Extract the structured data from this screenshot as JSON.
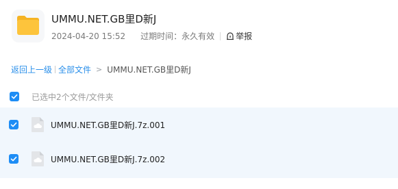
{
  "share": {
    "title": "UMMU.NET.GB里D新J",
    "date": "2024-04-20 15:52",
    "expire_label": "过期时间：永久有效",
    "report_label": "举报"
  },
  "breadcrumb": {
    "back": "返回上一级",
    "all_files": "全部文件",
    "separator": ">",
    "current": "UMMU.NET.GB里D新J"
  },
  "selection": {
    "summary": "已选中2个文件/文件夹"
  },
  "files": [
    {
      "name": "UMMU.NET.GB里D新J.7z.001",
      "checked": true,
      "icon": "cloud-file-icon"
    },
    {
      "name": "UMMU.NET.GB里D新J.7z.002",
      "checked": true,
      "icon": "cloud-file-icon"
    }
  ],
  "colors": {
    "accent": "#1e8df5",
    "link": "#2a8fea",
    "selected_row_bg": "#f1f7fd",
    "folder_yellow": "#fdc43c"
  }
}
